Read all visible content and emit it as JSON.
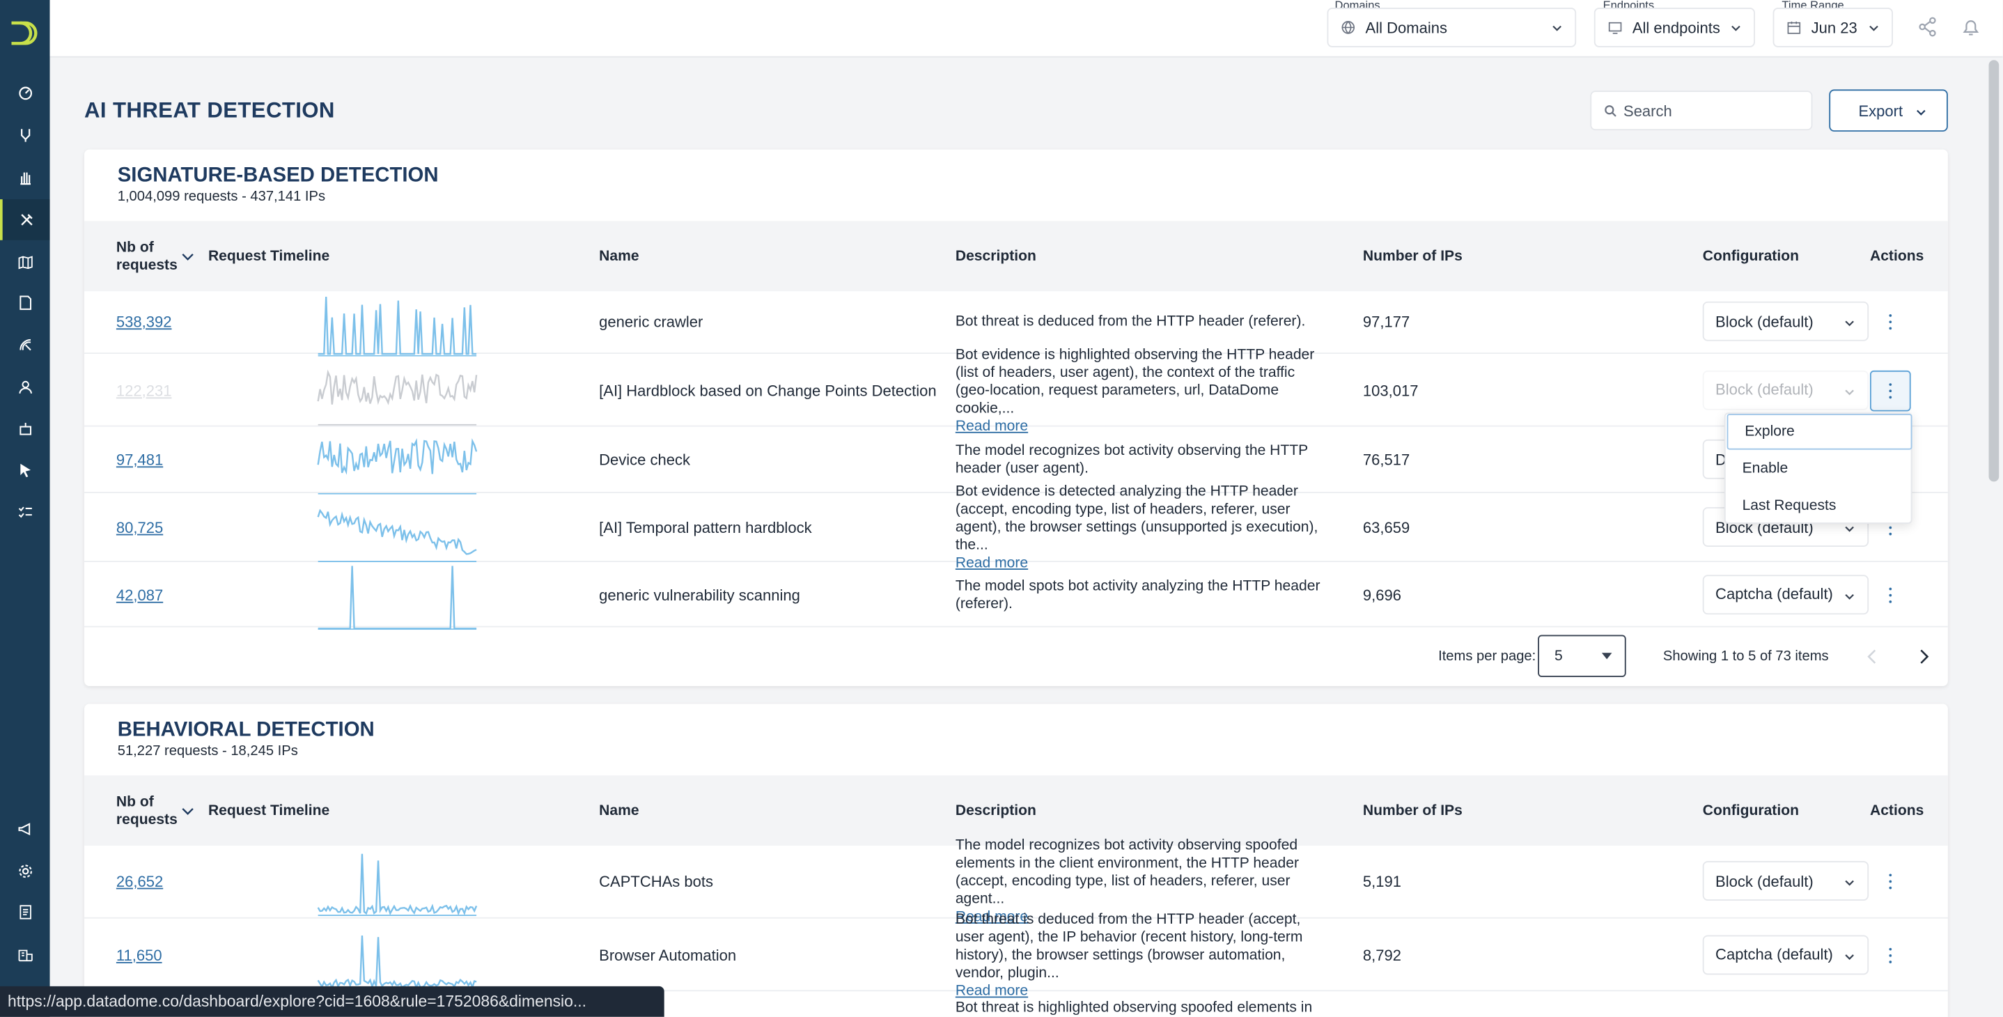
{
  "header": {
    "domains_label": "Domains",
    "domains_value": "All Domains",
    "endpoints_label": "Endpoints",
    "endpoints_value": "All endpoints",
    "time_label": "Time Range",
    "time_value": "Jun 23"
  },
  "page": {
    "title": "AI THREAT DETECTION",
    "search_placeholder": "Search",
    "export_label": "Export"
  },
  "columns": {
    "nb": "Nb of requests",
    "timeline": "Request Timeline",
    "name": "Name",
    "description": "Description",
    "ips": "Number of IPs",
    "configuration": "Configuration",
    "actions": "Actions"
  },
  "signature": {
    "title": "SIGNATURE-BASED DETECTION",
    "subtitle": "1,004,099 requests - 437,141 IPs",
    "rows": [
      {
        "requests": "538,392",
        "name": "generic crawler",
        "desc": "Bot threat is deduced from the HTTP header (referer).",
        "read_more": "",
        "ips": "97,177",
        "config": "Block (default)"
      },
      {
        "requests": "122,231",
        "name": "[AI] Hardblock based on Change Points Detection",
        "desc": "Bot evidence is highlighted observing the HTTP header (list of headers, user agent), the context of the traffic (geo-location, request parameters, url, DataDome cookie,...",
        "read_more": "Read more",
        "ips": "103,017",
        "config": "Block (default)"
      },
      {
        "requests": "97,481",
        "name": "Device check",
        "desc": "The model recognizes bot activity observing the HTTP header (user agent).",
        "read_more": "",
        "ips": "76,517",
        "config": "D"
      },
      {
        "requests": "80,725",
        "name": "[AI] Temporal pattern hardblock",
        "desc": "Bot evidence is detected analyzing the HTTP header (accept, encoding type, list of headers, referer, user agent), the browser settings (unsupported js execution), the...",
        "read_more": "Read more",
        "ips": "63,659",
        "config": "Block (default)"
      },
      {
        "requests": "42,087",
        "name": "generic vulnerability scanning",
        "desc": "The model spots bot activity analyzing the HTTP header (referer).",
        "read_more": "",
        "ips": "9,696",
        "config": "Captcha (default)"
      }
    ],
    "pager": {
      "items_per_page_label": "Items per page:",
      "items_per_page_value": "5",
      "showing": "Showing 1 to 5 of 73 items"
    }
  },
  "behavioral": {
    "title": "BEHAVIORAL DETECTION",
    "subtitle": "51,227 requests - 18,245 IPs",
    "rows": [
      {
        "requests": "26,652",
        "name": "CAPTCHAs bots",
        "desc": "The model recognizes bot activity observing spoofed elements in the client environment, the HTTP header (accept, encoding type, list of headers, referer, user agent...",
        "read_more": "Read more",
        "ips": "5,191",
        "config": "Block (default)"
      },
      {
        "requests": "11,650",
        "name": "Browser Automation",
        "desc": "Bot threat is deduced from the HTTP header (accept, user agent), the IP behavior (recent history, long-term history), the browser settings (browser automation, vendor, plugin...",
        "read_more": "Read more",
        "ips": "8,792",
        "config": "Captcha (default)"
      },
      {
        "requests": "",
        "name": "",
        "desc": "Bot threat is highlighted observing spoofed elements in the",
        "read_more": "",
        "ips": "",
        "config": ""
      }
    ]
  },
  "actions_menu": {
    "items": [
      "Explore",
      "Enable",
      "Last Requests"
    ]
  },
  "status_url": "https://app.datadome.co/dashboard/explore?cid=1608&rule=1752086&dimensio...",
  "icons": {
    "sidebar": [
      "dashboard-icon",
      "branch-icon",
      "hand-icon",
      "tools-icon",
      "map-icon",
      "document-icon",
      "radar-icon",
      "users-icon",
      "bot-icon",
      "cursor-icon",
      "checklist-icon",
      "megaphone-icon",
      "gear-icon",
      "report-icon",
      "building-icon"
    ],
    "top": [
      "share-icon",
      "bell-icon"
    ]
  },
  "colors": {
    "sidebar": "#1c3d57",
    "accent": "#c8e04a",
    "link": "#2e6da4",
    "spark": "#7cc0ea"
  }
}
